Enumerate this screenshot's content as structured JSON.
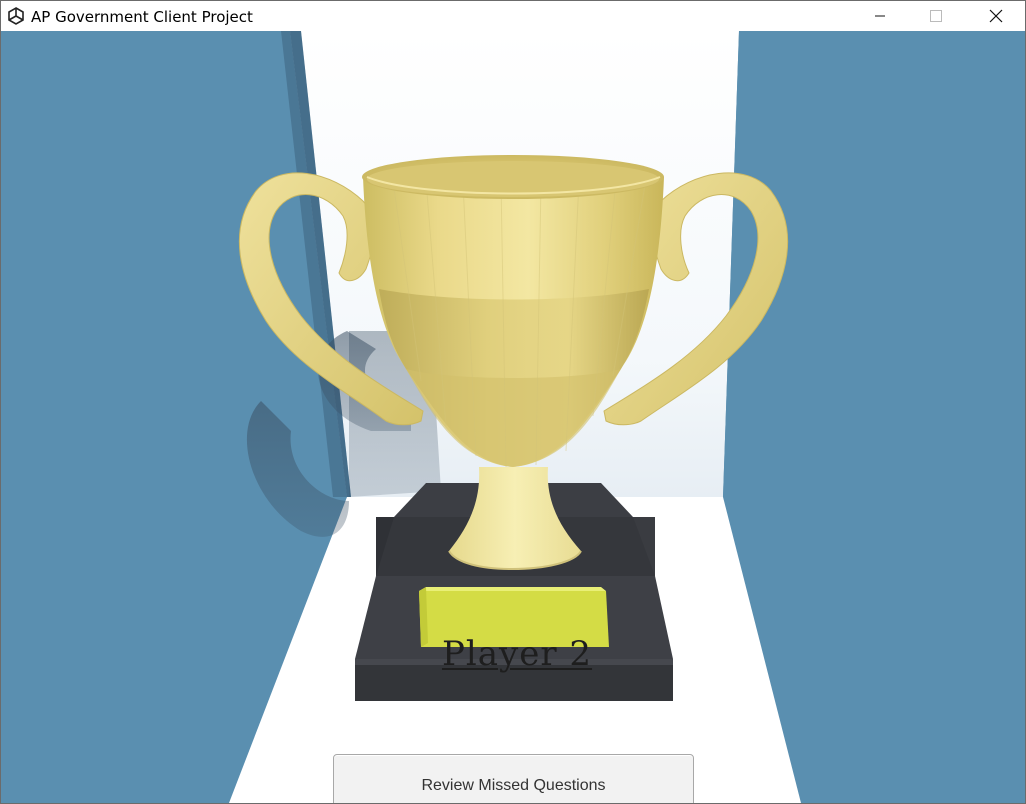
{
  "window": {
    "title": "AP Government Client Project",
    "icon": "unity-icon",
    "controls": [
      "minimize-icon",
      "maximize-icon",
      "close-icon"
    ]
  },
  "scene": {
    "plaque_text": "Player 2",
    "colors": {
      "sky_wall": "#5a8fb0",
      "trophy_gold": "#e6d886",
      "plaque_yellow": "#d9e04a",
      "pedestal": "#3f4147",
      "floor": "#ffffff"
    }
  },
  "button": {
    "label": "Review Missed Questions"
  }
}
